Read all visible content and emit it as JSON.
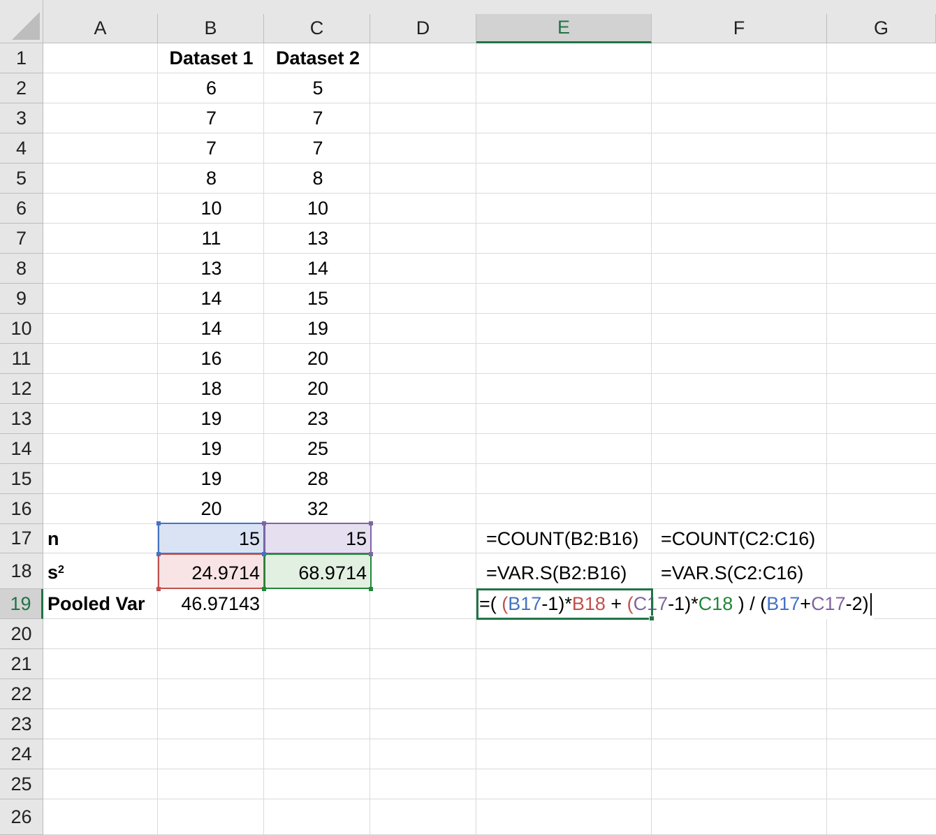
{
  "colors": {
    "header_bg": "#e6e6e6",
    "selected_accent": "#217346",
    "ref_blue": "#4472c4",
    "ref_red": "#c0504d",
    "ref_purple": "#8064a2",
    "ref_green": "#218739"
  },
  "columns": [
    "A",
    "B",
    "C",
    "D",
    "E",
    "F",
    "G"
  ],
  "selected_column": "E",
  "rows": [
    "1",
    "2",
    "3",
    "4",
    "5",
    "6",
    "7",
    "8",
    "9",
    "10",
    "11",
    "12",
    "13",
    "14",
    "15",
    "16",
    "17",
    "18",
    "19",
    "20",
    "21",
    "22",
    "23",
    "24",
    "25",
    "26"
  ],
  "selected_row": "19",
  "headers": {
    "b1": "Dataset 1",
    "c1": "Dataset 2"
  },
  "dataset1": [
    "6",
    "7",
    "7",
    "8",
    "10",
    "11",
    "13",
    "14",
    "14",
    "16",
    "18",
    "19",
    "19",
    "19",
    "20"
  ],
  "dataset2": [
    "5",
    "7",
    "7",
    "8",
    "10",
    "13",
    "14",
    "15",
    "19",
    "20",
    "20",
    "23",
    "25",
    "28",
    "32"
  ],
  "labels": {
    "a17": "n",
    "a18_base": "s",
    "a18_sup": "2",
    "a19": "Pooled Var"
  },
  "values": {
    "b17": "15",
    "c17": "15",
    "b18": "24.9714",
    "c18": "68.9714",
    "b19": "46.97143"
  },
  "formulas_shown": {
    "e17": "=COUNT(B2:B16)",
    "f17": "=COUNT(C2:C16)",
    "e18": "=VAR.S(B2:B16)",
    "f18": "=VAR.S(C2:C16)"
  },
  "active_formula": {
    "parts": [
      {
        "t": "=( ",
        "c": "black"
      },
      {
        "t": "(",
        "c": "red"
      },
      {
        "t": "B17",
        "c": "blue"
      },
      {
        "t": "-1)",
        "c": "black"
      },
      {
        "t": "*",
        "c": "black"
      },
      {
        "t": "B18",
        "c": "red"
      },
      {
        "t": " + ",
        "c": "black"
      },
      {
        "t": "(",
        "c": "red"
      },
      {
        "t": "C17",
        "c": "purple"
      },
      {
        "t": "-1)",
        "c": "black"
      },
      {
        "t": "*",
        "c": "black"
      },
      {
        "t": "C18",
        "c": "green"
      },
      {
        "t": " ) / (",
        "c": "black"
      },
      {
        "t": "B17",
        "c": "blue"
      },
      {
        "t": "+",
        "c": "black"
      },
      {
        "t": "C17",
        "c": "purple"
      },
      {
        "t": "-2)",
        "c": "black"
      }
    ]
  }
}
